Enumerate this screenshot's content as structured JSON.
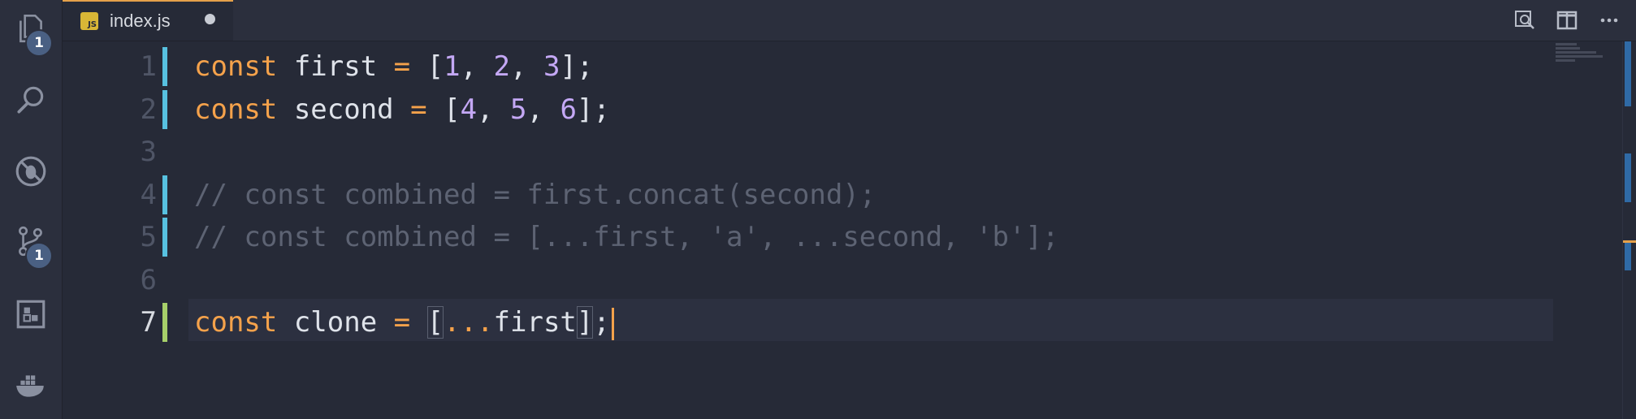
{
  "activity_bar": {
    "items": [
      {
        "name": "explorer",
        "icon": "files-icon",
        "badge": "1"
      },
      {
        "name": "search",
        "icon": "search-icon"
      },
      {
        "name": "debug",
        "icon": "no-bug-icon"
      },
      {
        "name": "source-control",
        "icon": "source-control-icon",
        "badge": "1"
      },
      {
        "name": "extensions",
        "icon": "extensions-icon"
      },
      {
        "name": "docker",
        "icon": "docker-icon"
      }
    ]
  },
  "tab": {
    "icon_label": "JS",
    "title": "index.js",
    "dirty": true
  },
  "toolbar": {
    "open_preview_icon": "search-preview-icon",
    "split_editor_icon": "split-editor-icon",
    "more_icon": "more-actions-icon"
  },
  "editor": {
    "active_line": 7,
    "lines": [
      {
        "number": "1",
        "gutter": "added",
        "tokens": [
          [
            "kw",
            "const"
          ],
          [
            "id",
            " first "
          ],
          [
            "op",
            "="
          ],
          [
            "pn",
            " ["
          ],
          [
            "num",
            "1"
          ],
          [
            "pn",
            ", "
          ],
          [
            "num",
            "2"
          ],
          [
            "pn",
            ", "
          ],
          [
            "num",
            "3"
          ],
          [
            "pn",
            "];"
          ]
        ]
      },
      {
        "number": "2",
        "gutter": "added",
        "tokens": [
          [
            "kw",
            "const"
          ],
          [
            "id",
            " second "
          ],
          [
            "op",
            "="
          ],
          [
            "pn",
            " ["
          ],
          [
            "num",
            "4"
          ],
          [
            "pn",
            ", "
          ],
          [
            "num",
            "5"
          ],
          [
            "pn",
            ", "
          ],
          [
            "num",
            "6"
          ],
          [
            "pn",
            "];"
          ]
        ]
      },
      {
        "number": "3",
        "gutter": "none",
        "tokens": []
      },
      {
        "number": "4",
        "gutter": "added",
        "tokens": [
          [
            "cm",
            "// const combined = first.concat(second);"
          ]
        ]
      },
      {
        "number": "5",
        "gutter": "added",
        "tokens": [
          [
            "cm",
            "// const combined = [...first, 'a', ...second, 'b'];"
          ]
        ]
      },
      {
        "number": "6",
        "gutter": "none",
        "tokens": []
      },
      {
        "number": "7",
        "gutter": "modified",
        "tokens": [
          [
            "kw",
            "const"
          ],
          [
            "id",
            " clone "
          ],
          [
            "op",
            "="
          ],
          [
            "pn",
            " "
          ],
          [
            "box",
            "["
          ],
          [
            "op",
            "..."
          ],
          [
            "id",
            "first"
          ],
          [
            "box",
            "]"
          ],
          [
            "pn",
            ";"
          ]
        ]
      }
    ]
  },
  "colors": {
    "accent": "#e5a04a",
    "keyword": "#f5a24b",
    "number": "#c4a8f5",
    "comment": "#5d6373",
    "gutter_added": "#57c1e0",
    "gutter_modified": "#a7d06a"
  }
}
